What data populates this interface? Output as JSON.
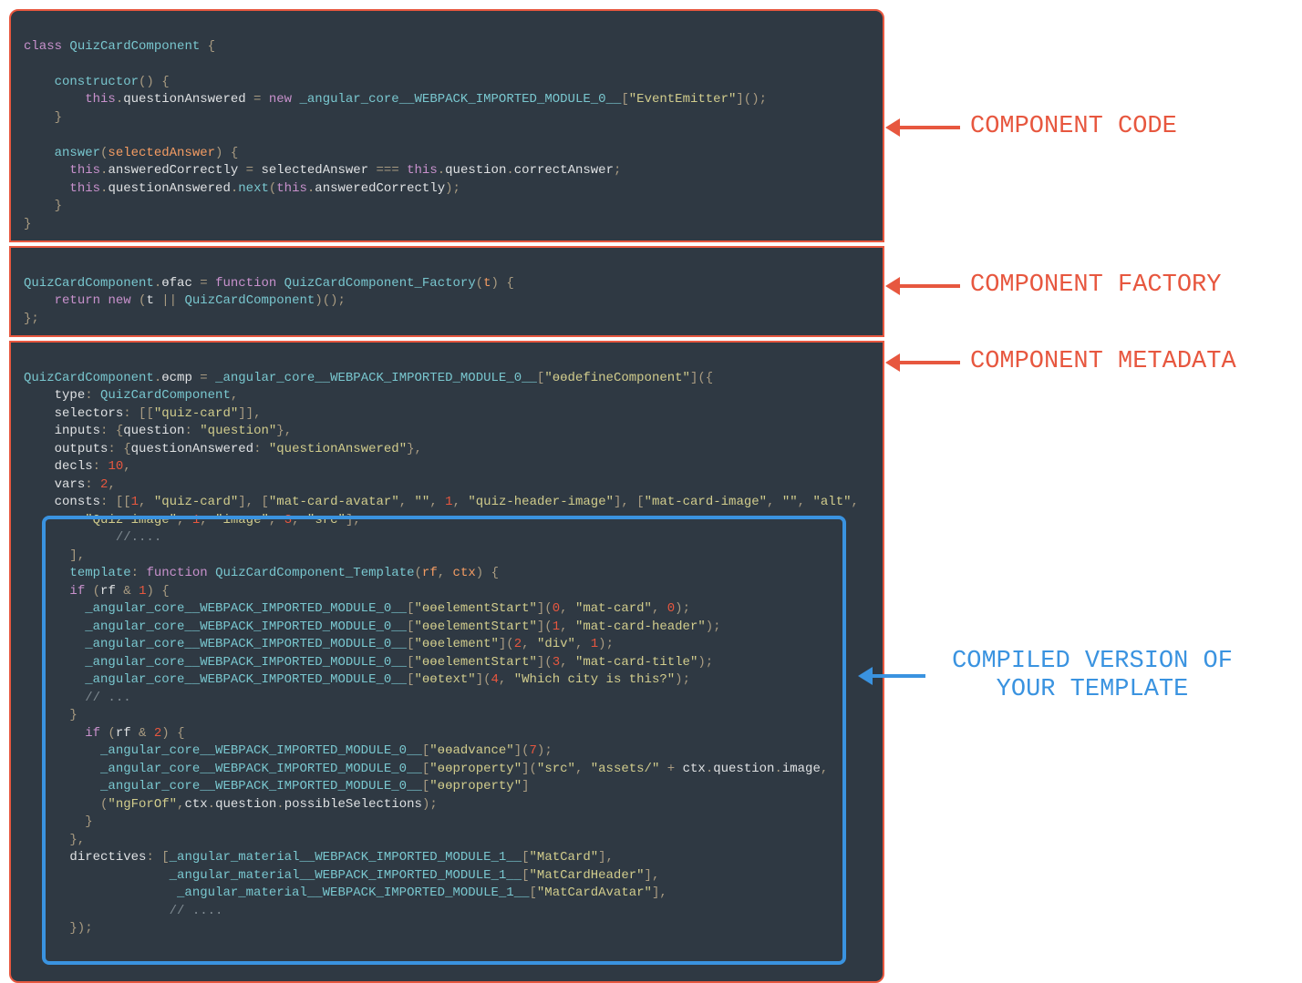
{
  "labels": {
    "component_code": "COMPONENT CODE",
    "component_factory": "COMPONENT FACTORY",
    "component_metadata": "COMPONENT METADATA",
    "compiled_template_l1": "COMPILED VERSION OF",
    "compiled_template_l2": "YOUR TEMPLATE"
  },
  "b1": {
    "l1a": "class",
    "l1b": " QuizCardComponent ",
    "l1c": "{",
    "l2a": "    constructor",
    "l2b": "()",
    "l2c": " {",
    "l3a": "        ",
    "l3b": "this",
    "l3c": ".",
    "l3d": "questionAnswered",
    "l3e": " = ",
    "l3f": "new",
    "l3g": " _angular_core__WEBPACK_IMPORTED_MODULE_0__",
    "l3h": "[",
    "l3i": "\"EventEmitter\"",
    "l3j": "]();",
    "l4a": "    }",
    "l5a": "    answer",
    "l5b": "(",
    "l5c": "selectedAnswer",
    "l5d": ")",
    "l5e": " {",
    "l6a": "      ",
    "l6b": "this",
    "l6c": ".",
    "l6d": "answeredCorrectly",
    "l6e": " = ",
    "l6f": "selectedAnswer",
    "l6g": " === ",
    "l6h": "this",
    "l6i": ".",
    "l6j": "question",
    "l6k": ".",
    "l6l": "correctAnswer",
    "l6m": ";",
    "l7a": "      ",
    "l7b": "this",
    "l7c": ".",
    "l7d": "questionAnswered",
    "l7e": ".",
    "l7f": "next",
    "l7g": "(",
    "l7h": "this",
    "l7i": ".",
    "l7j": "answeredCorrectly",
    "l7k": ");",
    "l8a": "    }",
    "l9a": "}"
  },
  "b2": {
    "l1a": "QuizCardComponent",
    "l1b": ".",
    "l1c": "ɵfac",
    "l1d": " = ",
    "l1e": "function",
    "l1f": " QuizCardComponent_Factory",
    "l1g": "(",
    "l1h": "t",
    "l1i": ") {",
    "l2a": "    ",
    "l2b": "return",
    "l2c": " ",
    "l2d": "new",
    "l2e": " (",
    "l2f": "t",
    "l2g": " || ",
    "l2h": "QuizCardComponent",
    "l2i": ")();",
    "l3a": "};"
  },
  "b3": {
    "l1a": "QuizCardComponent",
    "l1b": ".",
    "l1c": "ɵcmp",
    "l1d": " = ",
    "l1e": "_angular_core__WEBPACK_IMPORTED_MODULE_0__",
    "l1f": "[",
    "l1g": "\"ɵɵdefineComponent\"",
    "l1h": "]({",
    "l2a": "    ",
    "l2b": "type",
    "l2c": ": ",
    "l2d": "QuizCardComponent",
    "l2e": ",",
    "l3a": "    ",
    "l3b": "selectors",
    "l3c": ": [[",
    "l3d": "\"quiz-card\"",
    "l3e": "]],",
    "l4a": "    ",
    "l4b": "inputs",
    "l4c": ": {",
    "l4d": "question",
    "l4e": ": ",
    "l4f": "\"question\"",
    "l4g": "},",
    "l5a": "    ",
    "l5b": "outputs",
    "l5c": ": {",
    "l5d": "questionAnswered",
    "l5e": ": ",
    "l5f": "\"questionAnswered\"",
    "l5g": "},",
    "l6a": "    ",
    "l6b": "decls",
    "l6c": ": ",
    "l6d": "10",
    "l6e": ",",
    "l7a": "    ",
    "l7b": "vars",
    "l7c": ": ",
    "l7d": "2",
    "l7e": ",",
    "l8a": "    ",
    "l8b": "consts",
    "l8c": ": [[",
    "l8d": "1",
    "l8e": ", ",
    "l8f": "\"quiz-card\"",
    "l8g": "], [",
    "l8h": "\"mat-card-avatar\"",
    "l8i": ", ",
    "l8j": "\"\"",
    "l8k": ", ",
    "l8l": "1",
    "l8m": ", ",
    "l8n": "\"quiz-header-image\"",
    "l8o": "], [",
    "l8p": "\"mat-card-image\"",
    "l8q": ", ",
    "l8r": "\"\"",
    "l8s": ", ",
    "l8t": "\"alt\"",
    "l8u": ",",
    "l9a": "        ",
    "l9b": "\"Quiz image\"",
    "l9c": ", ",
    "l9d": "1",
    "l9e": ", ",
    "l9f": "\"image\"",
    "l9g": ", ",
    "l9h": "3",
    "l9i": ", ",
    "l9j": "\"src\"",
    "l9k": "],",
    "l10a": "            ",
    "l10b": "//....",
    "l11a": "      ],",
    "l12a": "      ",
    "l12b": "template",
    "l12c": ": ",
    "l12d": "function",
    "l12e": " QuizCardComponent_Template",
    "l12f": "(",
    "l12g": "rf",
    "l12h": ", ",
    "l12i": "ctx",
    "l12j": ") {",
    "l13a": "      ",
    "l13b": "if",
    "l13c": " (",
    "l13d": "rf",
    "l13e": " & ",
    "l13f": "1",
    "l13g": ") {",
    "l14a": "        ",
    "l14b": "_angular_core__WEBPACK_IMPORTED_MODULE_0__",
    "l14c": "[",
    "l14d": "\"ɵɵelementStart\"",
    "l14e": "](",
    "l14f": "0",
    "l14g": ", ",
    "l14h": "\"mat-card\"",
    "l14i": ", ",
    "l14j": "0",
    "l14k": ");",
    "l15a": "        ",
    "l15b": "_angular_core__WEBPACK_IMPORTED_MODULE_0__",
    "l15c": "[",
    "l15d": "\"ɵɵelementStart\"",
    "l15e": "](",
    "l15f": "1",
    "l15g": ", ",
    "l15h": "\"mat-card-header\"",
    "l15i": ");",
    "l16a": "        ",
    "l16b": "_angular_core__WEBPACK_IMPORTED_MODULE_0__",
    "l16c": "[",
    "l16d": "\"ɵɵelement\"",
    "l16e": "](",
    "l16f": "2",
    "l16g": ", ",
    "l16h": "\"div\"",
    "l16i": ", ",
    "l16j": "1",
    "l16k": ");",
    "l17a": "        ",
    "l17b": "_angular_core__WEBPACK_IMPORTED_MODULE_0__",
    "l17c": "[",
    "l17d": "\"ɵɵelementStart\"",
    "l17e": "](",
    "l17f": "3",
    "l17g": ", ",
    "l17h": "\"mat-card-title\"",
    "l17i": ");",
    "l18a": "        ",
    "l18b": "_angular_core__WEBPACK_IMPORTED_MODULE_0__",
    "l18c": "[",
    "l18d": "\"ɵɵtext\"",
    "l18e": "](",
    "l18f": "4",
    "l18g": ", ",
    "l18h": "\"Which city is this?\"",
    "l18i": ");",
    "l19a": "        ",
    "l19b": "// ...",
    "l20a": "      }",
    "l21a": "        ",
    "l21b": "if",
    "l21c": " (",
    "l21d": "rf",
    "l21e": " & ",
    "l21f": "2",
    "l21g": ") {",
    "l22a": "          ",
    "l22b": "_angular_core__WEBPACK_IMPORTED_MODULE_0__",
    "l22c": "[",
    "l22d": "\"ɵɵadvance\"",
    "l22e": "](",
    "l22f": "7",
    "l22g": ");",
    "l23a": "          ",
    "l23b": "_angular_core__WEBPACK_IMPORTED_MODULE_0__",
    "l23c": "[",
    "l23d": "\"ɵɵproperty\"",
    "l23e": "](",
    "l23f": "\"src\"",
    "l23g": ", ",
    "l23h": "\"assets/\"",
    "l23i": " + ",
    "l23j": "ctx",
    "l23k": ".",
    "l23l": "question",
    "l23m": ".",
    "l23n": "image",
    "l23o": ",",
    "l24a": "          ",
    "l24b": "_angular_core__WEBPACK_IMPORTED_MODULE_0__",
    "l24c": "[",
    "l24d": "\"ɵɵproperty\"",
    "l24e": "]",
    "l25a": "          (",
    "l25b": "\"ngForOf\"",
    "l25c": ",",
    "l25d": "ctx",
    "l25e": ".",
    "l25f": "question",
    "l25g": ".",
    "l25h": "possibleSelections",
    "l25i": ");",
    "l26a": "        }",
    "l27a": "      },",
    "l28a": "      ",
    "l28b": "directives",
    "l28c": ": [",
    "l28d": "_angular_material__WEBPACK_IMPORTED_MODULE_1__",
    "l28e": "[",
    "l28f": "\"MatCard\"",
    "l28g": "],",
    "l29a": "                   ",
    "l29b": "_angular_material__WEBPACK_IMPORTED_MODULE_1__",
    "l29c": "[",
    "l29d": "\"MatCardHeader\"",
    "l29e": "],",
    "l30a": "                    ",
    "l30b": "_angular_material__WEBPACK_IMPORTED_MODULE_1__",
    "l30c": "[",
    "l30d": "\"MatCardAvatar\"",
    "l30e": "],",
    "l31a": "                   ",
    "l31b": "// ....",
    "l32a": "      });"
  }
}
